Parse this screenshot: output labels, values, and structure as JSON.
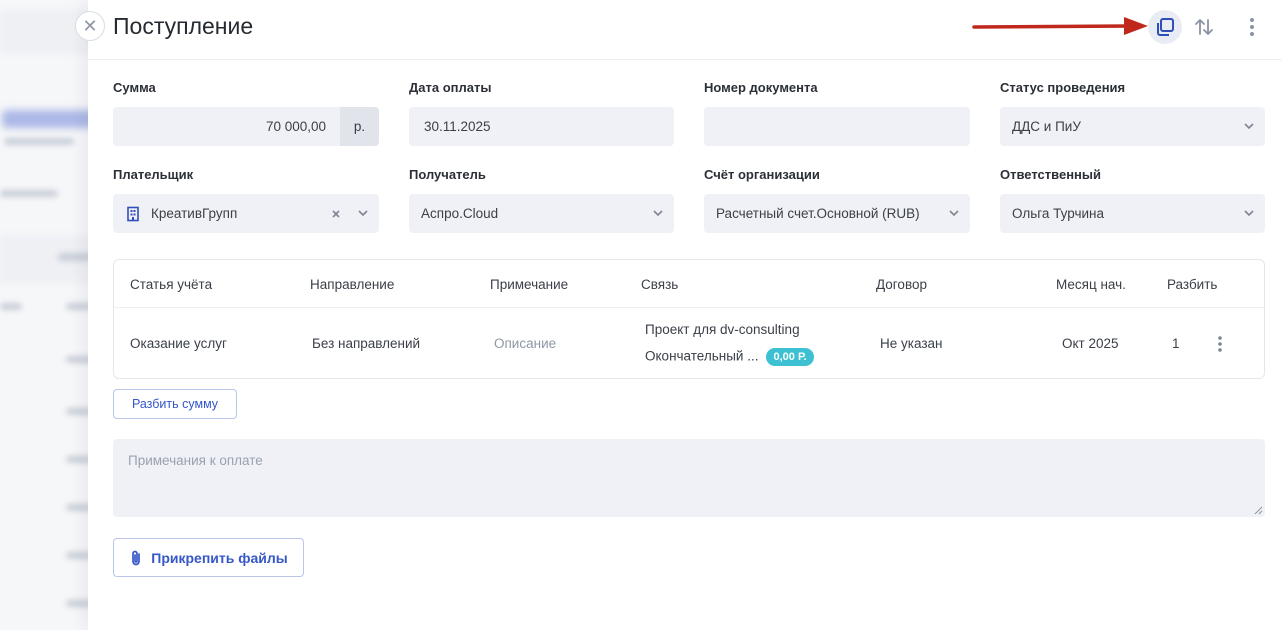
{
  "header": {
    "title": "Поступление"
  },
  "fields": {
    "amount": {
      "label": "Сумма",
      "value": "70 000,00",
      "currency": "р."
    },
    "pay_date": {
      "label": "Дата оплаты",
      "value": "30.11.2025"
    },
    "doc_number": {
      "label": "Номер документа",
      "value": ""
    },
    "status": {
      "label": "Статус проведения",
      "value": "ДДС и ПиУ"
    },
    "payer": {
      "label": "Плательщик",
      "value": "КреативГрупп"
    },
    "recipient": {
      "label": "Получатель",
      "value": "Аспро.Cloud"
    },
    "account": {
      "label": "Счёт организации",
      "value": "Расчетный счет.Основной (RUB)"
    },
    "responsible": {
      "label": "Ответственный",
      "value": "Ольга Турчина"
    }
  },
  "table": {
    "headers": {
      "article": "Статья учёта",
      "direction": "Направление",
      "note": "Примечание",
      "link": "Связь",
      "contract": "Договор",
      "month": "Месяц нач.",
      "split": "Разбить"
    },
    "rows": [
      {
        "article": "Оказание услуг",
        "direction": "Без направлений",
        "note": "Описание",
        "link_line1": "Проект для dv-consulting",
        "link_line2": "Окончательный ...",
        "link_badge": "0,00 Р.",
        "contract": "Не указан",
        "month": "Окт 2025",
        "split": "1"
      }
    ]
  },
  "buttons": {
    "split_sum": "Разбить сумму",
    "attach_files": "Прикрепить файлы"
  },
  "notes": {
    "placeholder": "Примечания к оплате"
  },
  "colors": {
    "accent": "#3557c8",
    "badge": "#3cc0d2",
    "annotation_arrow": "#c0281c",
    "field_bg": "#f0f1f6"
  }
}
